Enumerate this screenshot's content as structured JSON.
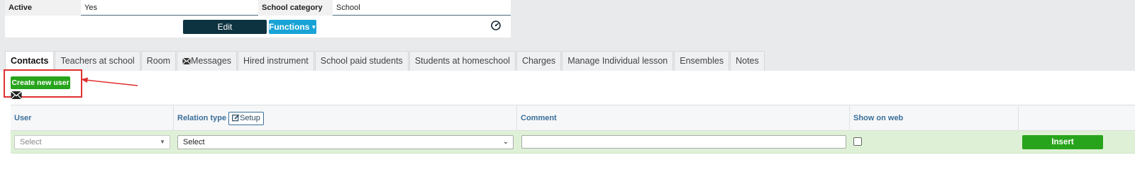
{
  "info": {
    "active_label": "Active",
    "active_value": "Yes",
    "category_label": "School category",
    "category_value": "School",
    "edit_label": "Edit",
    "functions_label": "Functions"
  },
  "tabs": [
    {
      "label": "Contacts",
      "active": true
    },
    {
      "label": "Teachers at school"
    },
    {
      "label": "Room"
    },
    {
      "label": "Messages",
      "icon": "envelope-icon"
    },
    {
      "label": "Hired instrument"
    },
    {
      "label": "School paid students"
    },
    {
      "label": "Students at homeschool"
    },
    {
      "label": "Charges"
    },
    {
      "label": "Manage Individual lesson"
    },
    {
      "label": "Ensembles"
    },
    {
      "label": "Notes"
    }
  ],
  "panel": {
    "create_user_label": "Create new user"
  },
  "table": {
    "headers": {
      "user": "User",
      "relation_type": "Relation type",
      "setup": "Setup",
      "comment": "Comment",
      "show_on_web": "Show on web"
    },
    "row": {
      "user_placeholder": "Select",
      "relation_value": "Select",
      "comment_value": "",
      "show_on_web_checked": false,
      "insert_label": "Insert"
    }
  },
  "colors": {
    "accent_green": "#28a41c",
    "edit_dark": "#0d3340",
    "functions_blue": "#18a3d6",
    "highlight_red": "#e03030"
  }
}
